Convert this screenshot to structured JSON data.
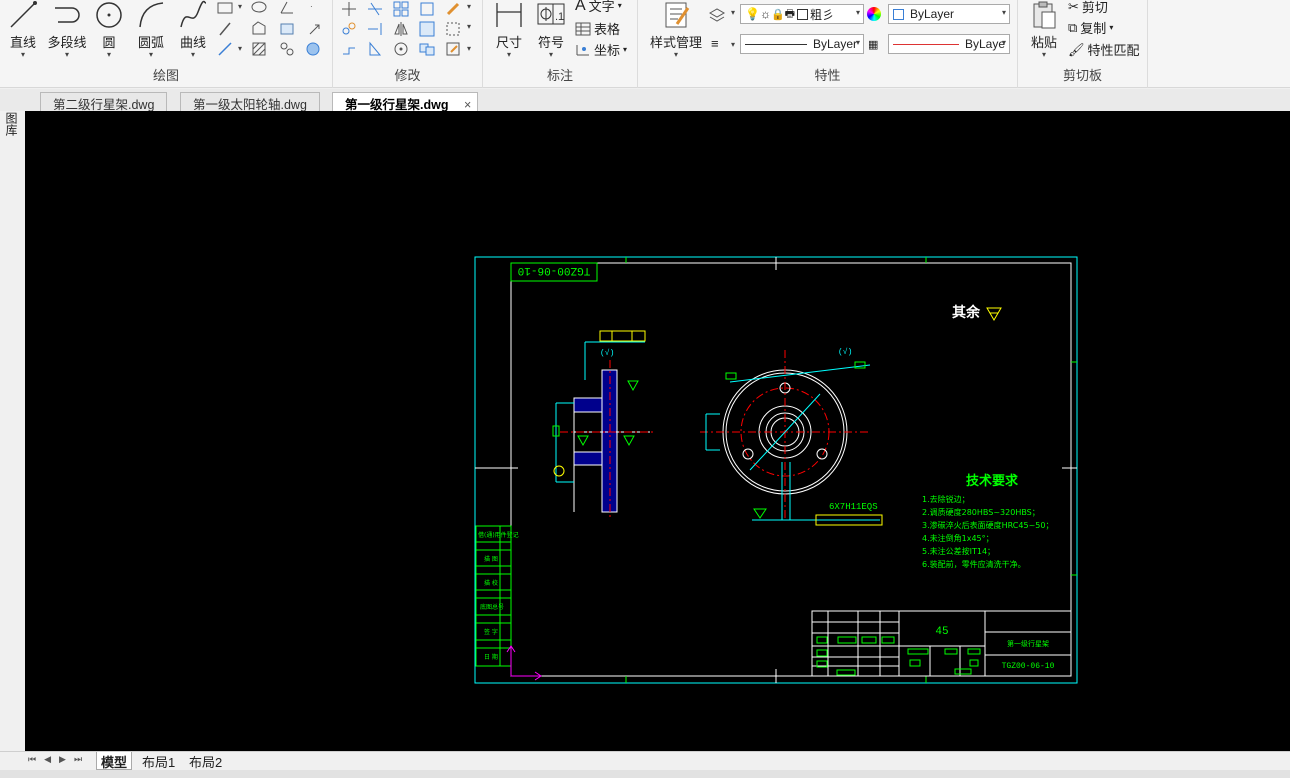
{
  "ribbon": {
    "draw": {
      "label": "绘图",
      "line": "直线",
      "polyline": "多段线",
      "circle": "圆",
      "arc": "圆弧",
      "curve": "曲线"
    },
    "modify": {
      "label": "修改"
    },
    "annotate": {
      "label": "标注",
      "dimension": "尺寸",
      "symbol": "符号",
      "text": "文字",
      "table": "表格",
      "coordinate": "坐标"
    },
    "properties": {
      "label": "特性",
      "style_manager": "样式管理",
      "lineweight_label": "粗彡",
      "color_value": "ByLayer",
      "linetype_value": "ByLayer",
      "lineweight_value": "ByLaye"
    },
    "clipboard": {
      "label": "剪切板",
      "paste": "粘贴",
      "cut": "剪切",
      "copy": "复制",
      "match": "特性匹配"
    }
  },
  "document_tabs": [
    {
      "label": "第二级行星架.dwg",
      "active": false
    },
    {
      "label": "第一级太阳轮轴.dwg",
      "active": false
    },
    {
      "label": "第一级行星架.dwg",
      "active": true
    }
  ],
  "side_panel": {
    "label": "图库"
  },
  "drawing": {
    "title_stamp": "TGZ00-06-10",
    "roughness_other": "其余",
    "tech_req_title": "技术要求",
    "tech_req_items": [
      "1.去除锐边；",
      "2.调质硬度280HBS~320HBS；",
      "3.渗碳淬火后表面硬度HRC45~50；",
      "4.未注倒角1x45°；",
      "5.未注公差按IT14；",
      "6.装配前，零件应清洗干净。"
    ],
    "spline_note": "6X7H11EQS",
    "material": "45",
    "part_name": "第一级行星架",
    "part_number": "TGZ00-06-10",
    "left_strip": [
      "借(通)用件登记",
      "描 图",
      "描 校",
      "底图总号",
      "签 字",
      "日 期"
    ],
    "roughness_label_1": "(√)",
    "colors": {
      "frame": "#00ffff",
      "text": "#00ff00",
      "center": "#ff0000",
      "part": "#ffffff",
      "hatch": "#0000ff",
      "dim": "#00ffff",
      "yellow": "#ffff00",
      "ucs": "#ff00ff"
    }
  },
  "layout_tabs": [
    "模型",
    "布局1",
    "布局2"
  ]
}
